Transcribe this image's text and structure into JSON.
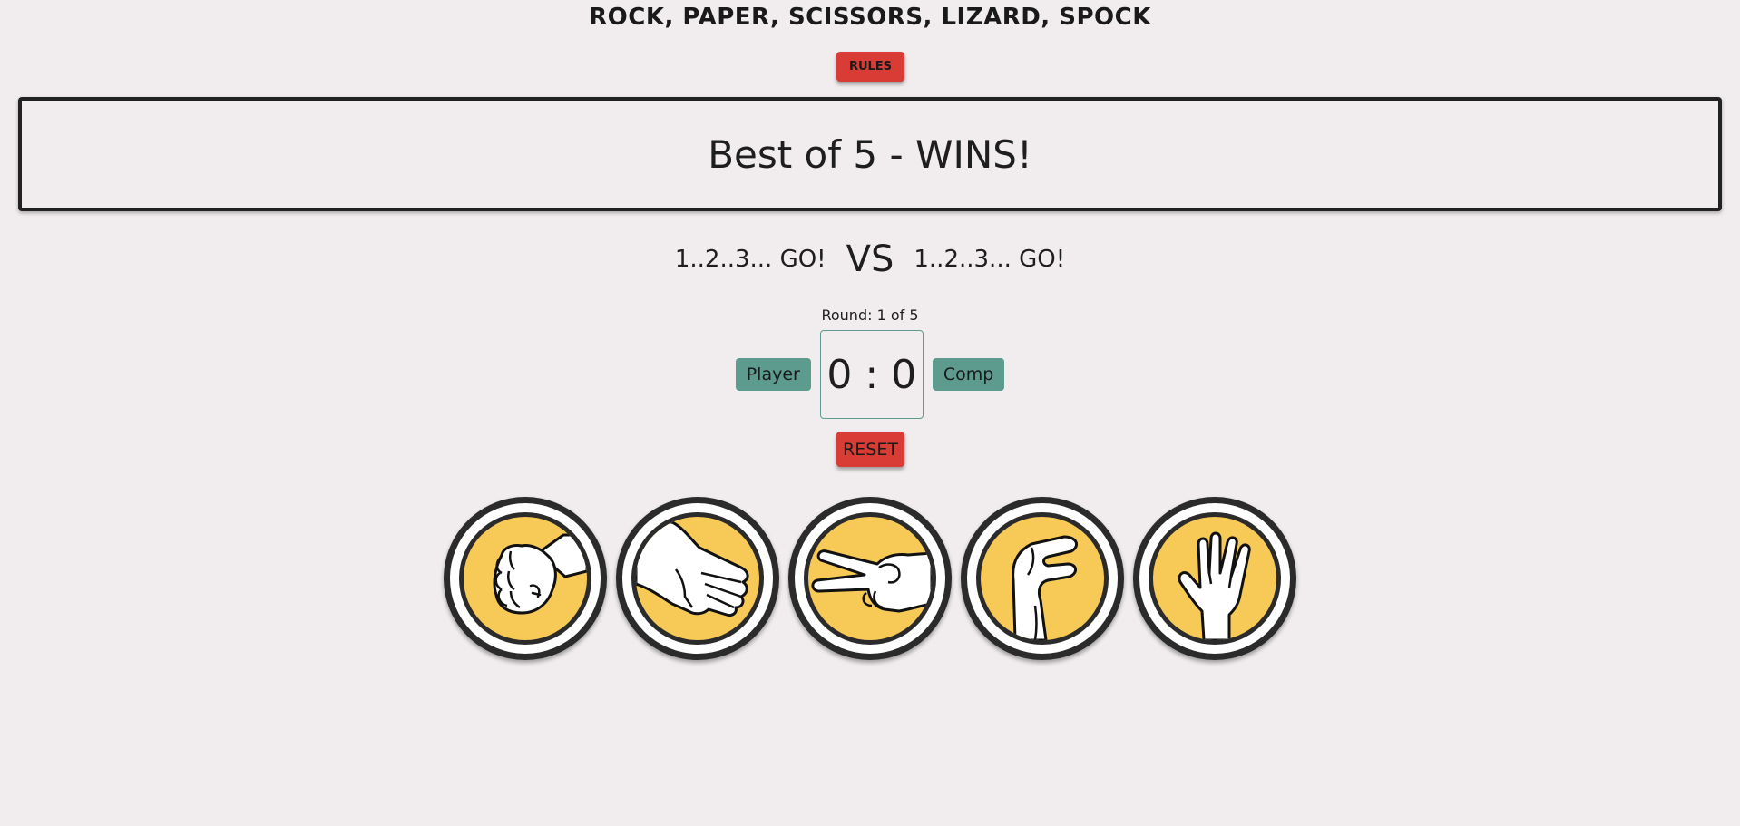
{
  "title": "ROCK, PAPER, SCISSORS, LIZARD, SPOCK",
  "rules_label": "RULES",
  "banner_text": "Best of 5 - WINS!",
  "player_choice": "1..2..3... GO!",
  "vs_label": "VS",
  "comp_choice": "1..2..3... GO!",
  "round_text": "Round: 1 of 5",
  "player_label": "Player",
  "comp_label": "Comp",
  "score": "0 : 0",
  "reset_label": "RESET",
  "choices": [
    {
      "name": "rock",
      "icon": "rock-hand-icon"
    },
    {
      "name": "paper",
      "icon": "paper-hand-icon"
    },
    {
      "name": "scissors",
      "icon": "scissors-hand-icon"
    },
    {
      "name": "lizard",
      "icon": "lizard-hand-icon"
    },
    {
      "name": "spock",
      "icon": "spock-hand-icon"
    }
  ],
  "colors": {
    "background": "#f1edee",
    "button_red": "#d93b35",
    "label_teal": "#5e9b8f",
    "token_yellow": "#f7c956",
    "token_dark": "#2b2b2b"
  }
}
